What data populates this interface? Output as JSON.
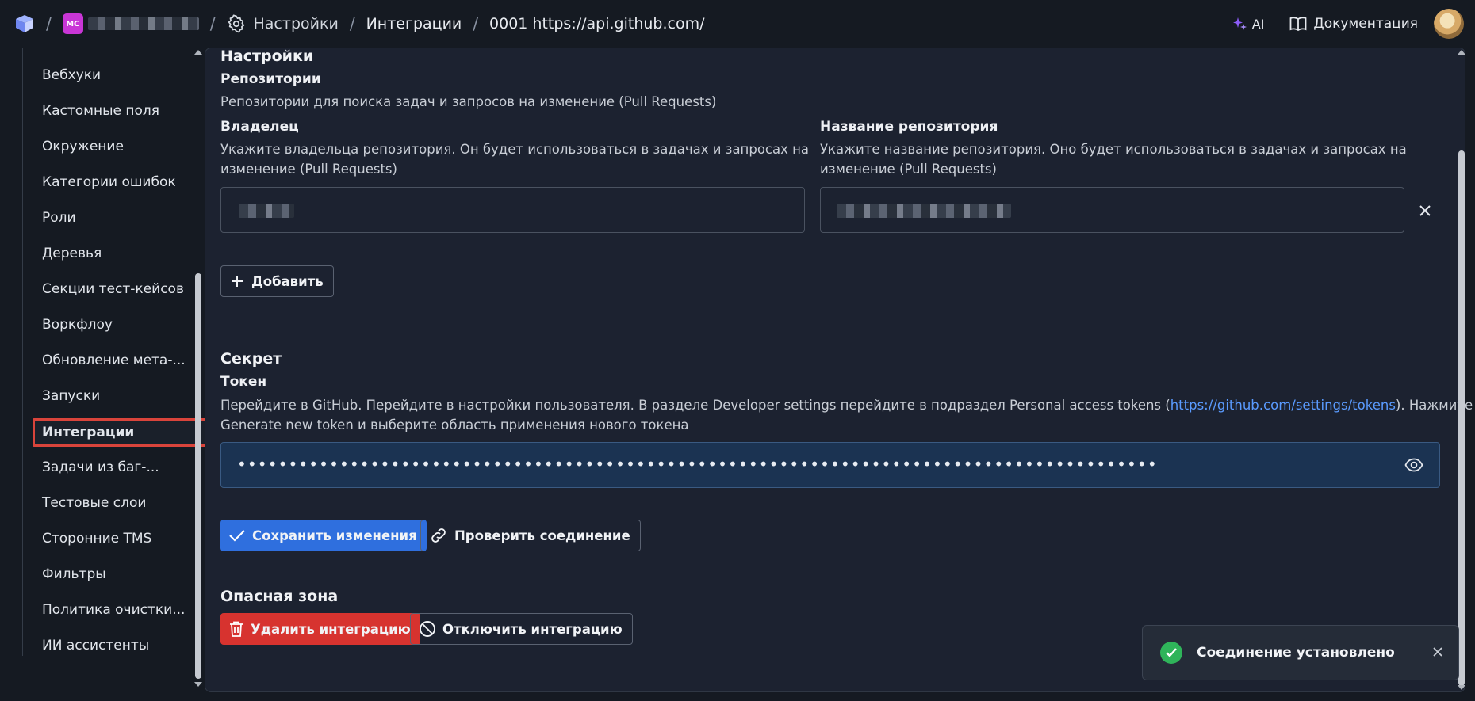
{
  "topbar": {
    "project_initials": "MC",
    "breadcrumb": {
      "settings": "Настройки",
      "integrations": "Интеграции",
      "current": "0001 https://api.github.com/"
    },
    "ai_label": "AI",
    "docs_label": "Документация"
  },
  "sidebar": {
    "items": [
      {
        "label": "Вебхуки"
      },
      {
        "label": "Кастомные поля"
      },
      {
        "label": "Окружение"
      },
      {
        "label": "Категории ошибок"
      },
      {
        "label": "Роли"
      },
      {
        "label": "Деревья"
      },
      {
        "label": "Секции тест-кейсов"
      },
      {
        "label": "Воркфлоу"
      },
      {
        "label": "Обновление мета-..."
      },
      {
        "label": "Запуски"
      },
      {
        "label": "Интеграции",
        "active": true
      },
      {
        "label": "Задачи из баг-..."
      },
      {
        "label": "Тестовые слои"
      },
      {
        "label": "Сторонние TMS"
      },
      {
        "label": "Фильтры"
      },
      {
        "label": "Политика очистки..."
      },
      {
        "label": "ИИ ассистенты"
      }
    ]
  },
  "settings": {
    "title": "Настройки",
    "repos_title": "Репозитории",
    "repos_desc": "Репозитории для поиска задач и запросов на изменение (Pull Requests)",
    "owner_label": "Владелец",
    "owner_desc_line1": "Укажите владельца репозитория. Он будет использоваться в задачах и запросах на",
    "owner_desc_line2": "изменение (Pull Requests)",
    "repo_label": "Название репозитория",
    "repo_desc_line1": "Укажите название репозитория. Оно будет использоваться в задачах и запросах на",
    "repo_desc_line2": "изменение (Pull Requests)",
    "add_button": "Добавить"
  },
  "secret": {
    "title": "Секрет",
    "token_label": "Токен",
    "token_desc_line1_a": "Перейдите в GitHub. Перейдите в настройки пользователя. В разделе Developer settings перейдите в подраздел Personal access tokens (",
    "token_desc_link": "https://github.com/settings/tokens",
    "token_desc_line1_b": "). Нажмите",
    "token_desc_line2": "Generate new token и выберите область применения нового токена",
    "token_value": "••••••••••••••••••••••••••••••••••••••••••••••••••••••••••••••••••••••••••••••••••••••••••"
  },
  "actions": {
    "save": "Сохранить изменения",
    "check": "Проверить соединение"
  },
  "danger": {
    "title": "Опасная зона",
    "delete": "Удалить интеграцию",
    "disable": "Отключить интеграцию"
  },
  "toast": {
    "message": "Соединение установлено"
  },
  "colors": {
    "background": "#151a22",
    "panel": "#1c2230",
    "primary": "#2f6fde",
    "danger": "#d7332f",
    "success": "#2fb45a",
    "highlight_border": "#d9443b",
    "link": "#5a9bff"
  }
}
